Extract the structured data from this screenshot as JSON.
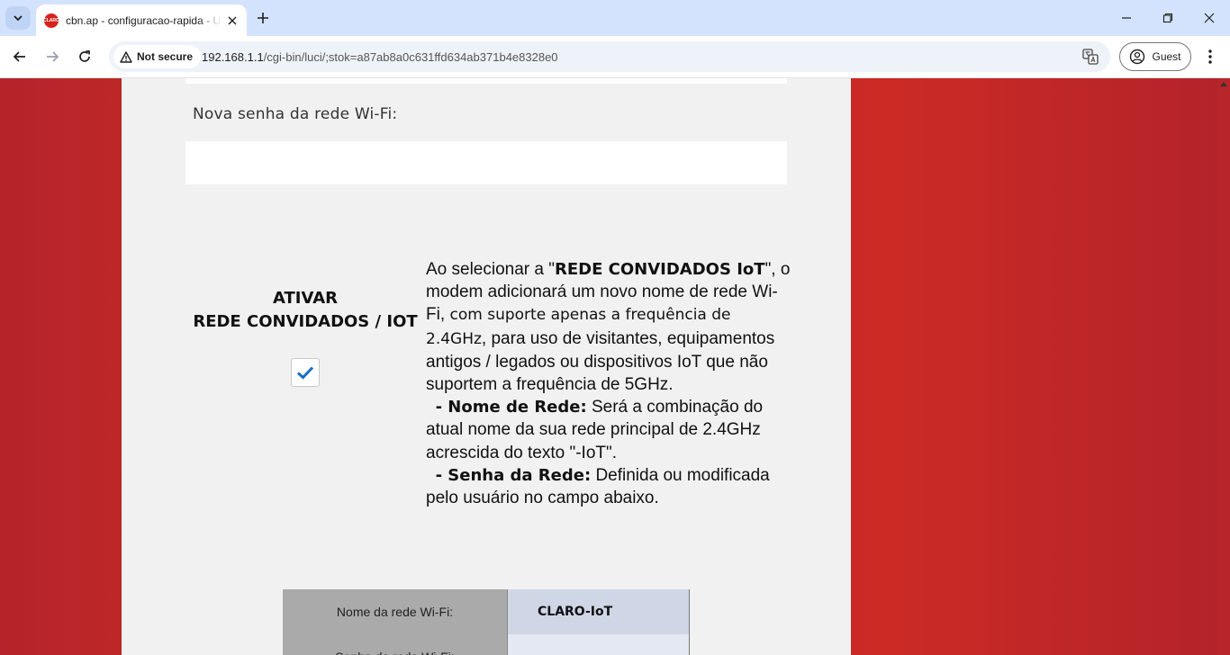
{
  "browser": {
    "tab_title": "cbn.ap - configuracao-rapida - UI",
    "favicon_text": "CLARO",
    "security_label": "Not secure",
    "url_host": "192.168.1.1",
    "url_path": "/cgi-bin/luci/;stok=a87ab8a0c631ffd634ab371b4e8328e0",
    "profile_label": "Guest"
  },
  "page": {
    "password_label": "Nova senha da rede Wi-Fi:",
    "password_value": "",
    "ativar_line1": "ATIVAR",
    "ativar_line2": "REDE CONVIDADOS / IOT",
    "checkbox_checked": true,
    "desc": {
      "p1_a": "Ao selecionar a \"",
      "p1_bold": "REDE CONVIDADOS IoT",
      "p1_b": "\", o modem adicionará um novo nome de rede Wi-Fi,",
      "p1_geo": " com suporte apenas a frequência de 2.4GHz",
      "p1_c": ", para uso de visitantes, equipamentos antigos / legados ou dispositivos IoT que não suportem a frequência de 5GHz.",
      "b1_label": "- Nome de Rede:",
      "b1_text": " Será a combinação do atual nome da sua rede principal de 2.4GHz acrescida do texto \"-IoT\".",
      "b2_label": "- Senha da Rede:",
      "b2_text": " Definida ou modificada pelo usuário no campo abaixo."
    },
    "table": {
      "rows": [
        {
          "label": "Nome da rede Wi-Fi:",
          "value": "CLARO-IoT"
        },
        {
          "label": "Senha da rede Wi-Fi:",
          "value": ""
        }
      ]
    }
  },
  "colors": {
    "background_red": "#b8262a",
    "panel": "#f1f1f1",
    "check_blue": "#1a6fc4"
  }
}
